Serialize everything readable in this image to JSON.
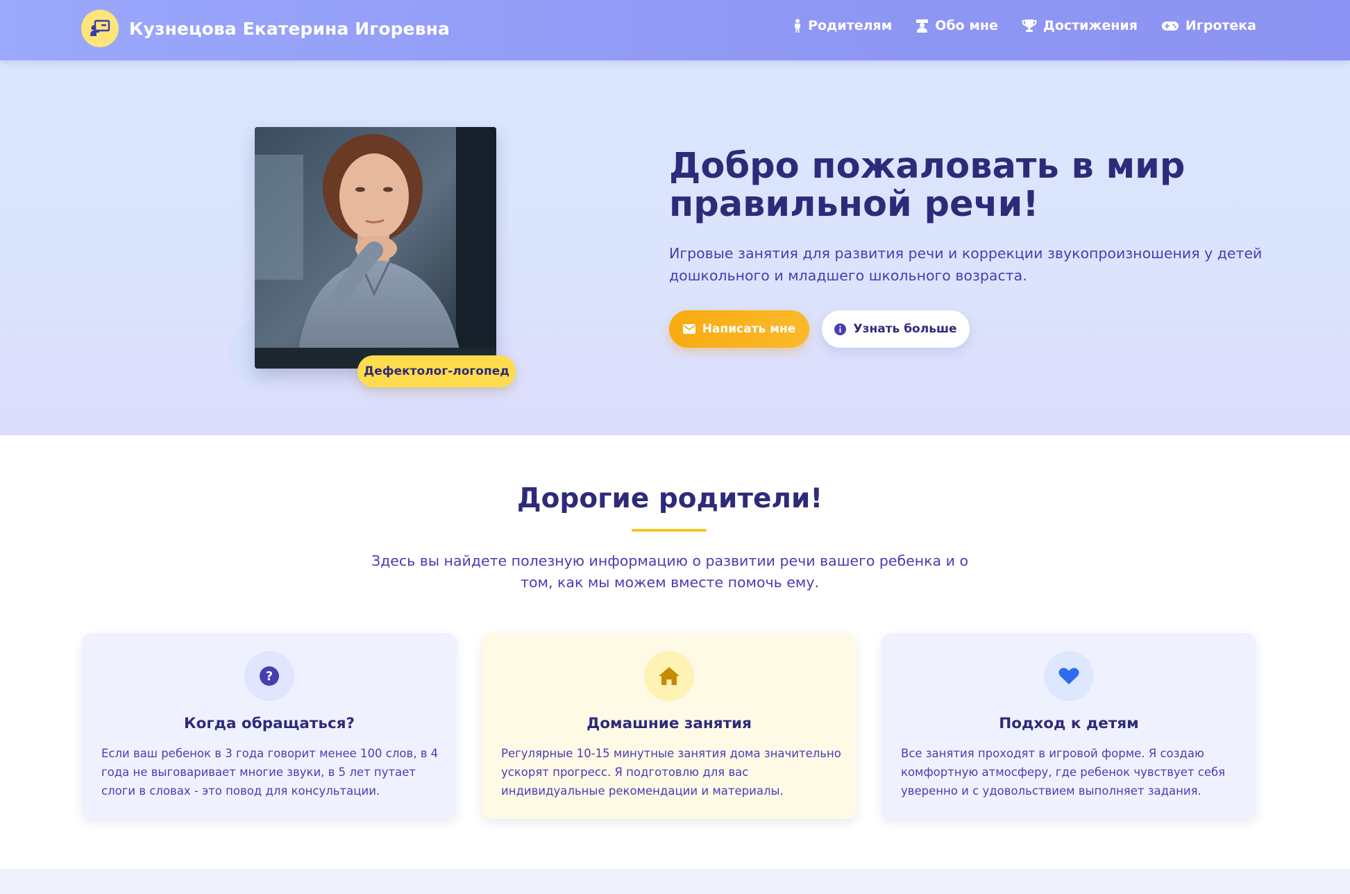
{
  "header": {
    "brand_name": "Кузнецова Екатерина Игоревна",
    "brand_icon": "teacher-board-icon",
    "nav": [
      {
        "label": "Родителям",
        "icon": "child-icon"
      },
      {
        "label": "Обо мне",
        "icon": "teacher-icon"
      },
      {
        "label": "Достижения",
        "icon": "trophy-icon"
      },
      {
        "label": "Игротека",
        "icon": "gamepad-icon"
      }
    ]
  },
  "hero": {
    "title": "Добро пожаловать в мир правильной речи!",
    "subtitle": "Игровые занятия для развития речи и коррекции звукопроизношения у детей дошкольного и младшего школьного возраста.",
    "badge": "Дефектолог-логопед",
    "primary_button": {
      "label": "Написать мне",
      "icon": "envelope-icon"
    },
    "secondary_button": {
      "label": "Узнать больше",
      "icon": "info-icon"
    }
  },
  "parents": {
    "title": "Дорогие родители!",
    "intro": "Здесь вы найдете полезную информацию о развитии речи вашего ребенка и о том, как мы можем вместе помочь ему.",
    "cards": [
      {
        "icon": "question-icon",
        "title": "Когда обращаться?",
        "text": "Если ваш ребенок в 3 года говорит менее 100 слов, в 4 года не выговаривает многие звуки, в 5 лет путает слоги в словах - это повод для консультации."
      },
      {
        "icon": "home-icon",
        "title": "Домашние занятия",
        "text": "Регулярные 10-15 минутные занятия дома значительно ускорят прогресс. Я подготовлю для вас индивидуальные рекомендации и материалы."
      },
      {
        "icon": "heart-icon",
        "title": "Подход к детям",
        "text": "Все занятия проходят в игровой форме. Я создаю комфортную атмосферу, где ребенок чувствует себя уверенно и с удовольствием выполняет задания."
      }
    ]
  },
  "colors": {
    "header": "#9ba8fb",
    "accent_yellow": "#fedc4d",
    "accent_orange": "#f8ab10",
    "heading": "#2d2b79",
    "body_text": "#4a3cb2"
  }
}
